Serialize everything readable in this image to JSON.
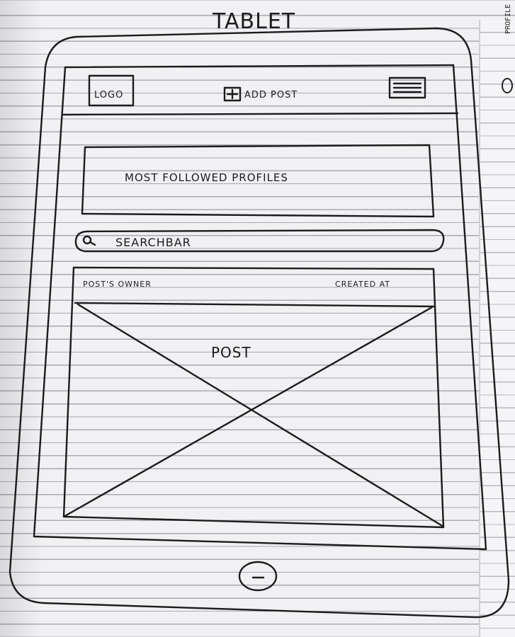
{
  "title": "TABLET",
  "header": {
    "logo_label": "LOGO",
    "add_post_label": "ADD POST",
    "add_icon": "plus-box-icon",
    "menu_icon": "hamburger-menu-icon"
  },
  "most_followed": {
    "label": "MOST FOLLOWED PROFILES"
  },
  "search": {
    "icon": "search-icon",
    "label": "SEARCHBAR"
  },
  "post": {
    "owner_label": "POST'S OWNER",
    "created_label": "CREATED AT",
    "content_label": "POST"
  },
  "home_button": {
    "icon": "minus-icon"
  },
  "next_page": {
    "text": "PROFILE"
  },
  "colors": {
    "ink": "#1c1c1c",
    "paper": "#f1f0f3",
    "rule_lines": "#a9a9b1"
  }
}
